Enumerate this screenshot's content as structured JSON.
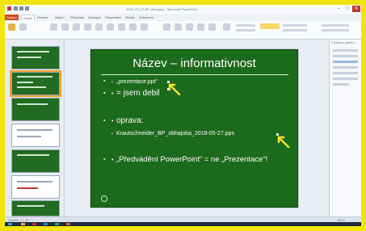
{
  "window": {
    "title": "2018_09_27 BP_obhajoba - Microsoft PowerPoint",
    "minimize": "–",
    "maximize": "□",
    "close": "✕"
  },
  "ribbon_tabs": [
    "Soubor",
    "Domů",
    "Vložení",
    "Návrh",
    "Přechody",
    "Animace",
    "Prezentace",
    "Revize",
    "Zobrazení"
  ],
  "slide": {
    "title": "Název – informativnost",
    "bullets": [
      {
        "text": "„prezentace.ppt“",
        "level": 2
      },
      {
        "text": "= jsem debil",
        "level": 1
      },
      {
        "text": "oprava:",
        "level": 1
      },
      {
        "text": "Krautschneider_BP_obhajoba_2018-05-27.pps",
        "level": 2
      },
      {
        "text": "„Předvádění PowerPoint“ = ne „Prezentace“!",
        "level": 1
      }
    ]
  },
  "side_pane": {
    "title": "Podokno výběru",
    "items": [
      "Název 1",
      "Obsah",
      "TextBox",
      "Šipka",
      "Šipka",
      "Ovál"
    ]
  },
  "status": {
    "left": "Snímek 3 z 12",
    "right": "68 %"
  },
  "icons": {
    "cursor": "pointer-arrow-icon",
    "footer": "circle-icon"
  },
  "colors": {
    "slide_bg": "#1c6a1c",
    "accent_yellow": "#f2e22a",
    "file_tab": "#d24726"
  }
}
